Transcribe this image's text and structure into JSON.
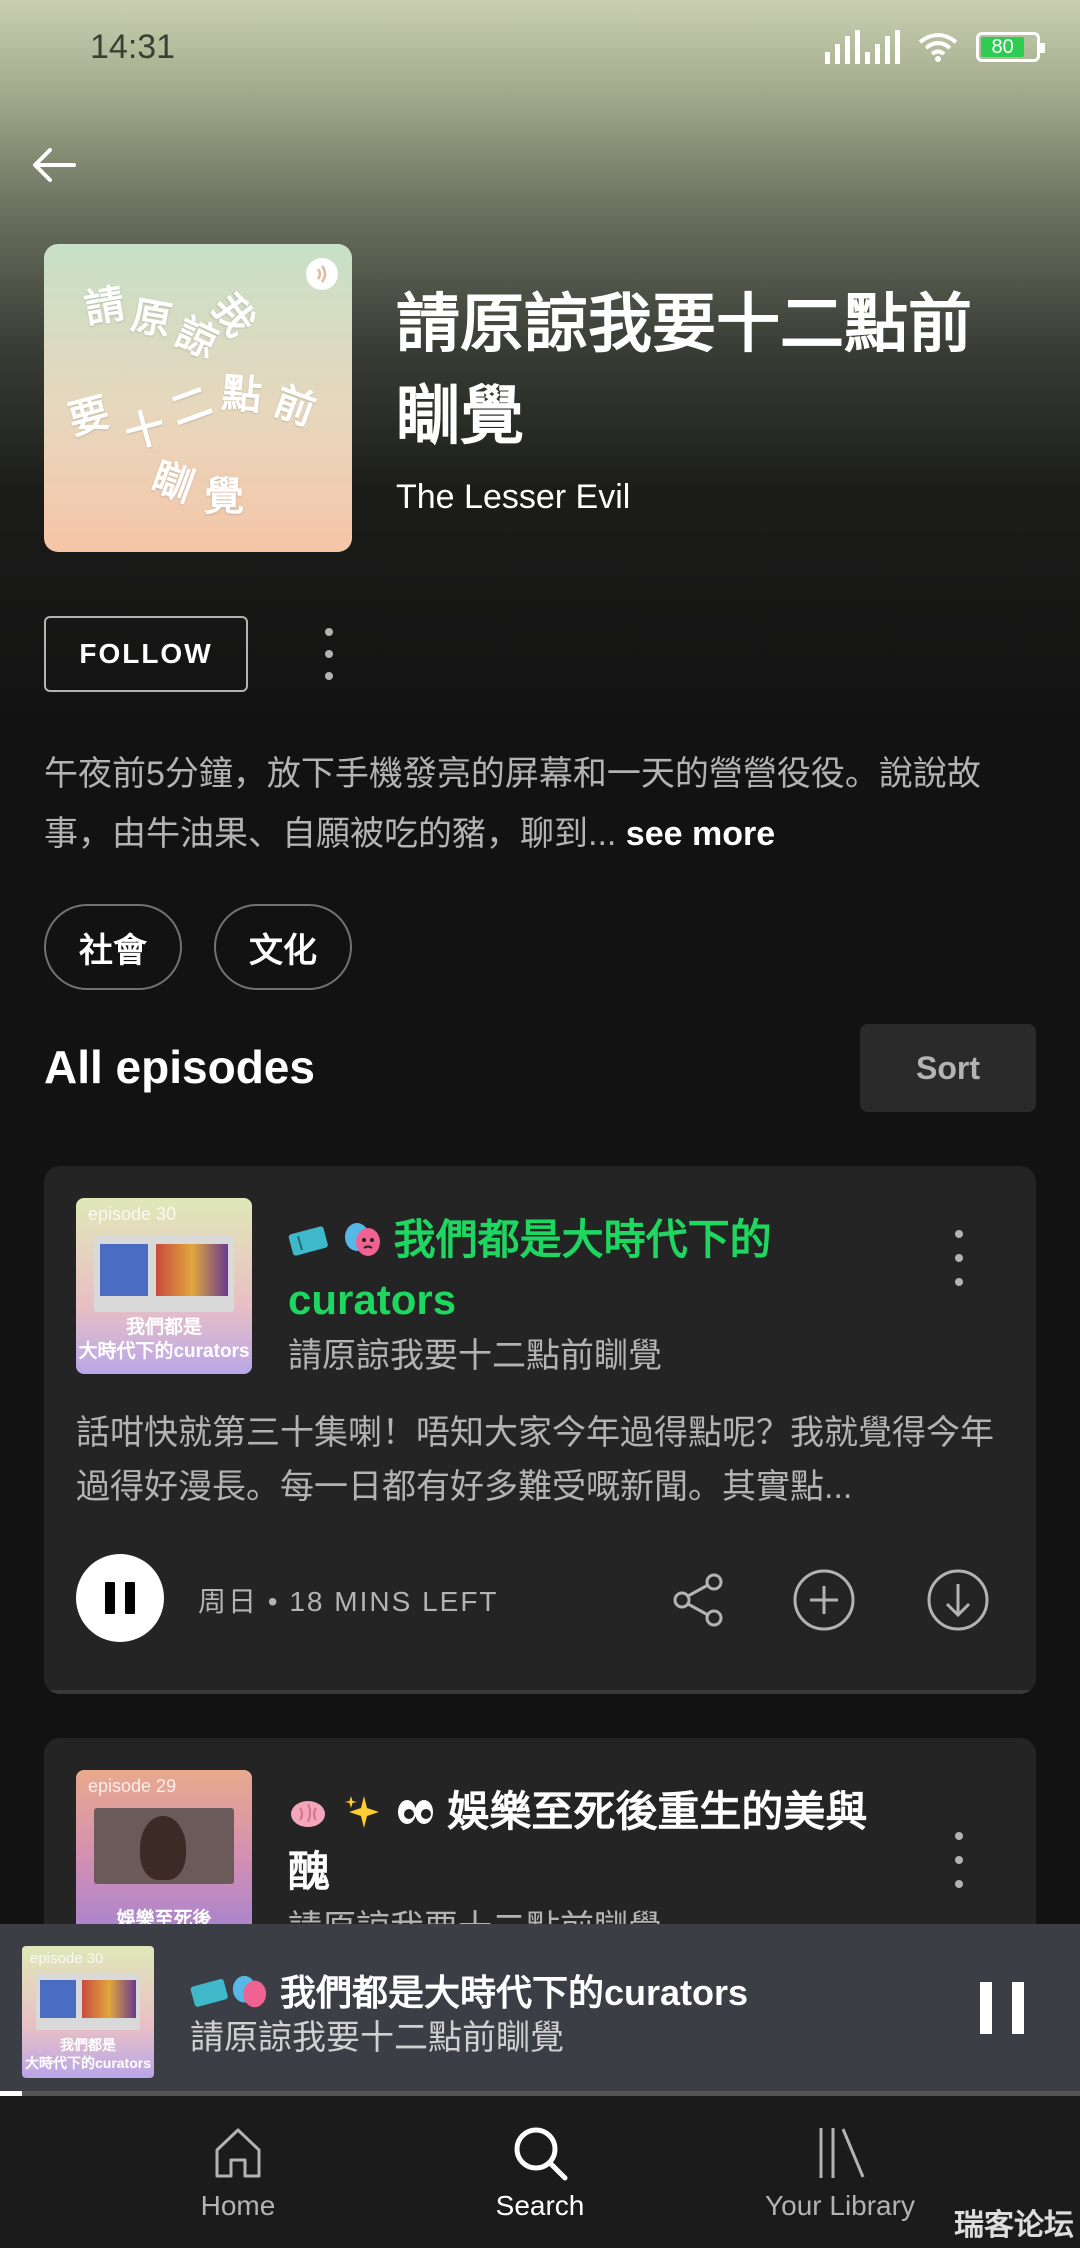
{
  "status_bar": {
    "time": "14:31",
    "battery": "80"
  },
  "show": {
    "title": "請原諒我要十二點前瞓覺",
    "author": "The Lesser Evil",
    "cover_chars": [
      "請",
      "原",
      "諒",
      "我",
      "要",
      "十",
      "二",
      "點",
      "前",
      "瞓",
      "覺"
    ],
    "follow_label": "FOLLOW",
    "description": "午夜前5分鐘，放下手機發亮的屏幕和一天的營營役役。說說故事，由牛油果、自願被吃的豬，聊到...",
    "see_more": "see more",
    "tags": [
      "社會",
      "文化"
    ]
  },
  "episodes_section": {
    "title": "All episodes",
    "sort_label": "Sort"
  },
  "episodes": [
    {
      "thumb_label": "episode 30",
      "thumb_caption_1": "我們都是",
      "thumb_caption_2": "大時代下的curators",
      "title": "我們都是大時代下的curators",
      "title_color": "#1ed760",
      "emojis": [
        "ticket",
        "performing-arts"
      ],
      "show": "請原諒我要十二點前瞓覺",
      "description": "話咁快就第三十集喇！唔知大家今年過得點呢？我就覺得今年過得好漫長。每一日都有好多難受嘅新聞。其實點...",
      "meta": "周日 • 18 MINS LEFT"
    },
    {
      "thumb_label": "episode 29",
      "thumb_caption_1": "娛樂至死後",
      "title": "娛樂至死後重生的美與醜",
      "title_color": "#ffffff",
      "emojis": [
        "brain",
        "sparkles",
        "eyes"
      ],
      "show": "請原諒我要十二點前瞓覺"
    }
  ],
  "mini_player": {
    "title": "我們都是大時代下的curators",
    "show": "請原諒我要十二點前瞓覺",
    "thumb_label": "episode 30",
    "thumb_caption_1": "我們都是",
    "thumb_caption_2": "大時代下的curators",
    "progress": 0.02
  },
  "nav": {
    "home": "Home",
    "search": "Search",
    "library": "Your Library",
    "active": "search"
  },
  "watermark": "瑞客论坛"
}
